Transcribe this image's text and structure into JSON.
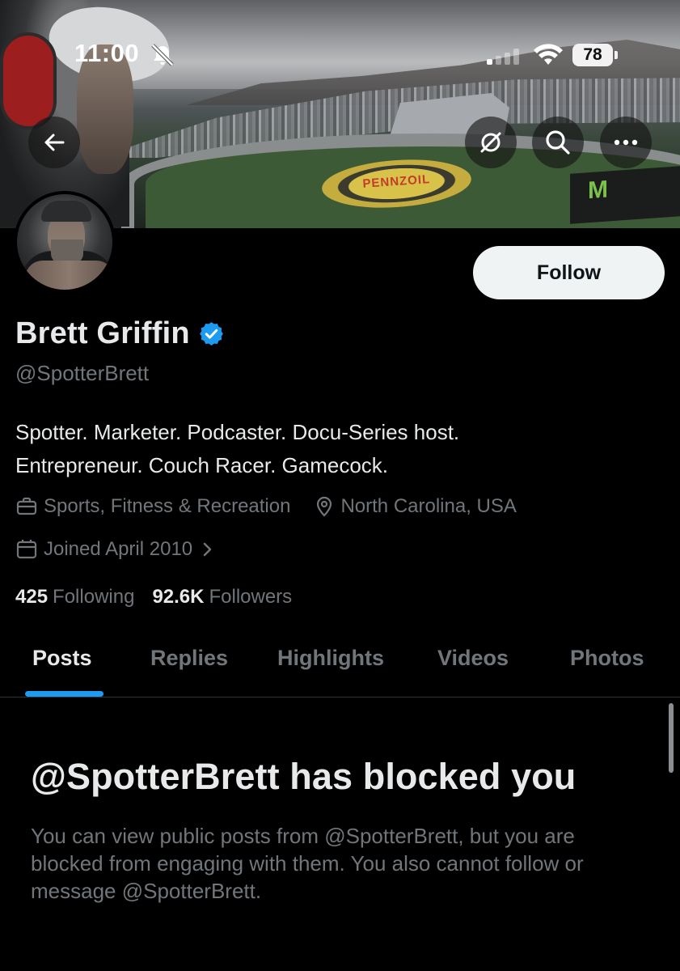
{
  "status_bar": {
    "time": "11:00",
    "battery": "78",
    "icons": [
      "bell-muted-icon",
      "cellular-signal-icon",
      "wifi-icon",
      "battery-icon"
    ]
  },
  "header": {
    "buttons": [
      "back-arrow-icon",
      "grok-icon",
      "search-icon",
      "more-icon"
    ]
  },
  "banner": {
    "pennzoil_text": "PENNZOIL",
    "monster_text": "M"
  },
  "profile": {
    "name": "Brett Griffin",
    "handle": "@SpotterBrett",
    "follow_label": "Follow",
    "bio_line1": "Spotter. Marketer. Podcaster. Docu-Series host.",
    "bio_line2": "Entrepreneur. Couch Racer. Gamecock.",
    "category": "Sports, Fitness & Recreation",
    "location": "North Carolina, USA",
    "joined": "Joined April 2010",
    "following_count": "425",
    "following_label": "Following",
    "followers_count": "92.6K",
    "followers_label": "Followers"
  },
  "tabs": [
    {
      "label": "Posts",
      "active": true
    },
    {
      "label": "Replies",
      "active": false
    },
    {
      "label": "Highlights",
      "active": false
    },
    {
      "label": "Videos",
      "active": false
    },
    {
      "label": "Photos",
      "active": false
    }
  ],
  "blocked": {
    "title": "@SpotterBrett has blocked you",
    "body": "You can view public posts from @SpotterBrett, but you are blocked from engaging with them. You also cannot follow or message @SpotterBrett."
  },
  "colors": {
    "background": "#000000",
    "accent": "#1d9bf0",
    "text_primary": "#e7e9ea",
    "text_secondary": "#71767b",
    "follow_bg": "#eff3f4"
  }
}
